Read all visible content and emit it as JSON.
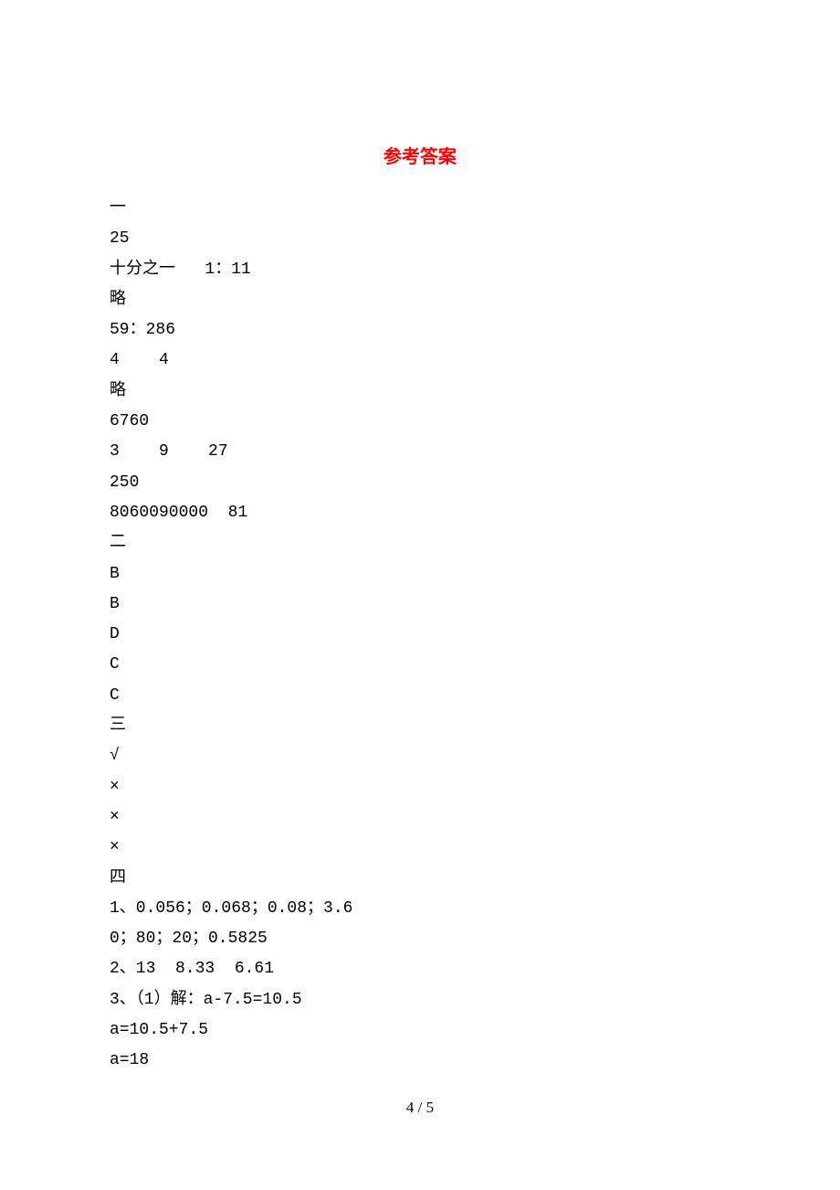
{
  "title": "参考答案",
  "lines": [
    "一",
    "25",
    "十分之一   1：11",
    "略",
    "59：286",
    "4    4",
    "略",
    "6760",
    "3    9    27",
    "250",
    "8060090000  81",
    "二",
    "B",
    "B",
    "D",
    "C",
    "C",
    "三",
    "√",
    "×",
    "×",
    "×",
    "四",
    "1、0.056；0.068；0.08；3.6",
    "0；80；20；0.5825",
    "2、13  8.33  6.61",
    "3、（1）解：a-7.5=10.5",
    "a=10.5+7.5",
    "a=18"
  ],
  "footer": "4 / 5"
}
